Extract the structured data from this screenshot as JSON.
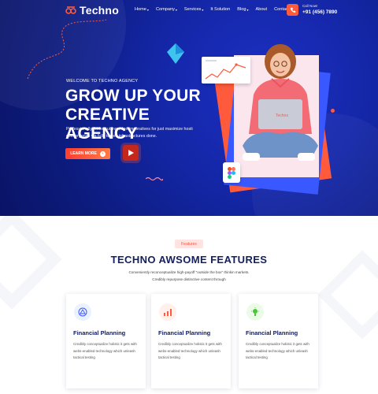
{
  "brand": {
    "name": "Techno"
  },
  "nav": {
    "items": [
      {
        "label": "Home",
        "has_caret": true
      },
      {
        "label": "Company",
        "has_caret": true
      },
      {
        "label": "Services",
        "has_caret": true
      },
      {
        "label": "It Solution",
        "has_caret": false
      },
      {
        "label": "Blog",
        "has_caret": true
      },
      {
        "label": "About",
        "has_caret": false
      },
      {
        "label": "Contact",
        "has_caret": false
      }
    ],
    "call_label": "Call Now!",
    "call_number": "+91 (456) 7890"
  },
  "hero": {
    "eyebrow": "WELCOME TO TECHNO AGENCY",
    "headline_line1": "GROW UP YOUR",
    "headline_line2": "CREATIVE AGENCY",
    "lead": "Professionally foster cutting-edge imperatives for just maximize hosti convergence via fully tested infrastructures done.",
    "cta_label": "LEARN MORE",
    "laptop_brand": "Techno"
  },
  "features": {
    "tag": "Features",
    "title": "TECHNO AWSOME FEATURES",
    "description": "Conveniently reconceptualize high-payoff \"outside the box\" thinkin markets. Credibly repurpose distinctive content through",
    "cards": [
      {
        "title": "Financial Planning",
        "icon": "planning-icon",
        "description": "Credibly conceptualize holistic it gets with webs-enabled technology which unleash tactical testing"
      },
      {
        "title": "Financial Planning",
        "icon": "chart-icon",
        "description": "Credibly conceptualize holistic it gets with webs-enabled technology which unleash tactical testing"
      },
      {
        "title": "Financial Planning",
        "icon": "lightbulb-icon",
        "description": "Credibly conceptualize holistic it gets with webs-enabled technology which unleash tactical testing"
      }
    ]
  },
  "colors": {
    "hero_bg": "#1427a8",
    "accent": "#ff5a3c",
    "heading": "#142060"
  }
}
